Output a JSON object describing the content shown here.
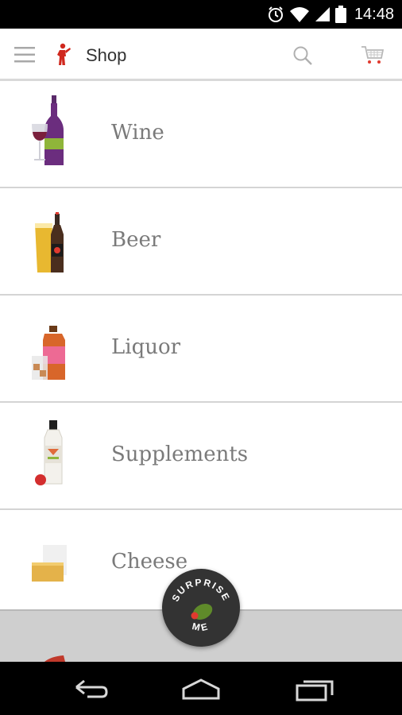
{
  "status_bar": {
    "time": "14:48"
  },
  "app_bar": {
    "title": "Shop"
  },
  "categories": [
    {
      "label": "Wine"
    },
    {
      "label": "Beer"
    },
    {
      "label": "Liquor"
    },
    {
      "label": "Supplements"
    },
    {
      "label": "Cheese"
    }
  ],
  "fab": {
    "line1": "SURPRISE",
    "line2": "ME"
  },
  "colors": {
    "accent_red": "#e03a2f",
    "olive_green": "#5f8a2a",
    "label_gray": "#7a7a7a"
  }
}
